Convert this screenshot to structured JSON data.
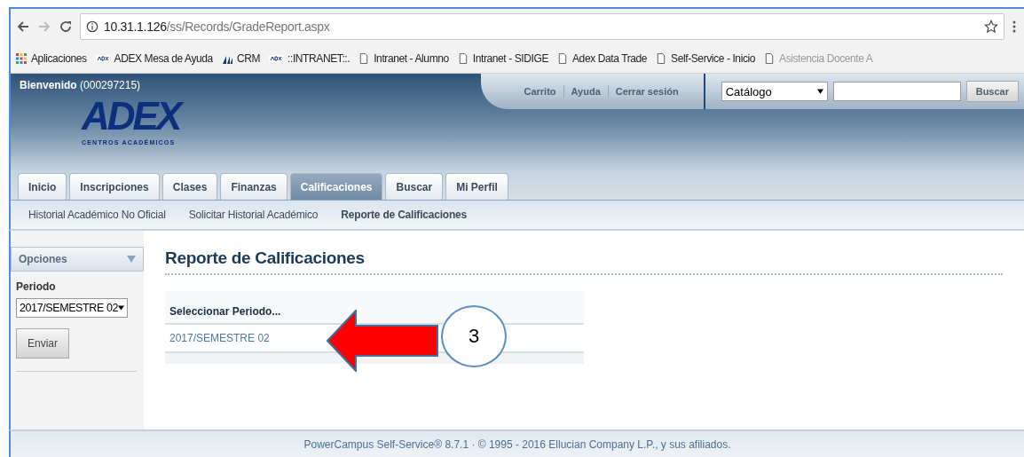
{
  "browser": {
    "url_host": "10.31.1.126",
    "url_path": "/ss/Records/GradeReport.aspx",
    "bookmarks": [
      {
        "label": "Aplicaciones",
        "kind": "apps"
      },
      {
        "label": "ADEX Mesa de Ayuda",
        "kind": "logo"
      },
      {
        "label": "CRM",
        "kind": "sail"
      },
      {
        "label": "::INTRANET::.",
        "kind": "logo"
      },
      {
        "label": "Intranet - Alumno",
        "kind": "page"
      },
      {
        "label": "Intranet - SIDIGE",
        "kind": "page"
      },
      {
        "label": "Adex Data Trade",
        "kind": "page"
      },
      {
        "label": "Self-Service - Inicio",
        "kind": "page"
      },
      {
        "label": "Asistencia Docente A",
        "kind": "page"
      }
    ]
  },
  "header": {
    "welcome": "Bienvenido",
    "user_id": "(000297215)",
    "logo": "ADEX",
    "logo_sub": "CENTROS ACADÉMICOS",
    "links": [
      "Carrito",
      "Ayuda",
      "Cerrar sesión"
    ],
    "search": {
      "scope": "Catálogo",
      "button": "Buscar"
    }
  },
  "tabs": [
    {
      "label": "Inicio",
      "selected": false
    },
    {
      "label": "Inscripciones",
      "selected": false
    },
    {
      "label": "Clases",
      "selected": false
    },
    {
      "label": "Finanzas",
      "selected": false
    },
    {
      "label": "Calificaciones",
      "selected": true
    },
    {
      "label": "Buscar",
      "selected": false
    },
    {
      "label": "Mi Perfil",
      "selected": false
    }
  ],
  "subnav": [
    {
      "label": "Historial Académico No Oficial",
      "selected": false
    },
    {
      "label": "Solicitar Historial Académico",
      "selected": false
    },
    {
      "label": "Reporte de Calificaciones",
      "selected": true
    }
  ],
  "sidebar": {
    "title": "Opciones",
    "period_label": "Periodo",
    "period_value": "2017/SEMESTRE 02",
    "button": "Enviar"
  },
  "content": {
    "title": "Reporte de Calificaciones",
    "table_header": "Seleccionar Periodo...",
    "rows": [
      "2017/SEMESTRE 02"
    ]
  },
  "annotation": {
    "number": "3"
  },
  "footer": "PowerCampus Self-Service® 8.7.1 · © 1995 - 2016 Ellucian Company L.P., y sus afiliados."
}
